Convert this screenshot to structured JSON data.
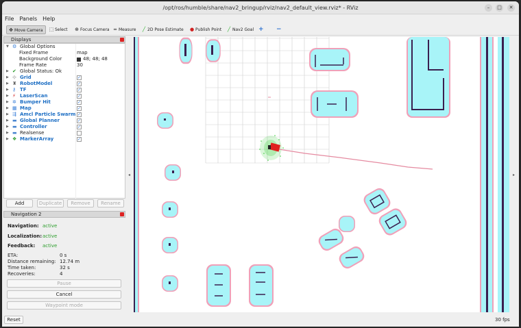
{
  "window": {
    "title": "/opt/ros/humble/share/nav2_bringup/rviz/nav2_default_view.rviz* - RViz",
    "minimize": "–",
    "maximize": "□",
    "close": "✕"
  },
  "menu": {
    "file": "File",
    "panels": "Panels",
    "help": "Help"
  },
  "toolbar": {
    "move_camera": "Move Camera",
    "select": "Select",
    "focus_camera": "Focus Camera",
    "measure": "Measure",
    "pose_estimate": "2D Pose Estimate",
    "publish_point": "Publish Point",
    "nav2_goal": "Nav2 Goal",
    "add_tool": "+",
    "remove_tool": "−"
  },
  "displays": {
    "title": "Displays",
    "items": [
      {
        "label": "Global Options",
        "icon": "gear-icon",
        "expanded": true
      },
      {
        "label": "Fixed Frame",
        "value": "map"
      },
      {
        "label": "Background Color",
        "value": "48; 48; 48"
      },
      {
        "label": "Frame Rate",
        "value": "30"
      },
      {
        "label": "Global Status: Ok",
        "icon": "check-icon"
      },
      {
        "label": "Grid",
        "icon": "grid-icon",
        "checked": true
      },
      {
        "label": "RobotModel",
        "icon": "robot-icon",
        "checked": true
      },
      {
        "label": "TF",
        "icon": "tf-icon",
        "checked": true
      },
      {
        "label": "LaserScan",
        "icon": "laser-icon",
        "checked": true
      },
      {
        "label": "Bumper Hit",
        "icon": "bumper-icon",
        "checked": true
      },
      {
        "label": "Map",
        "icon": "map-icon",
        "checked": true
      },
      {
        "label": "Amcl Particle Swarm",
        "icon": "particle-icon",
        "checked": true
      },
      {
        "label": "Global Planner",
        "icon": "folder-icon",
        "checked": true
      },
      {
        "label": "Controller",
        "icon": "folder-icon",
        "checked": true
      },
      {
        "label": "Realsense",
        "icon": "folder-icon",
        "checked": false
      },
      {
        "label": "MarkerArray",
        "icon": "marker-icon",
        "checked": true
      }
    ],
    "buttons": {
      "add": "Add",
      "duplicate": "Duplicate",
      "remove": "Remove",
      "rename": "Rename"
    }
  },
  "navigation": {
    "title": "Navigation 2",
    "navigation_label": "Navigation:",
    "navigation_value": "active",
    "localization_label": "Localization:",
    "localization_value": "active",
    "feedback_label": "Feedback:",
    "feedback_value": "active",
    "eta_label": "ETA:",
    "eta_value": "0 s",
    "distance_label": "Distance remaining:",
    "distance_value": "12.74 m",
    "time_label": "Time taken:",
    "time_value": "32 s",
    "recoveries_label": "Recoveries:",
    "recoveries_value": "4",
    "pause": "Pause",
    "cancel": "Cancel",
    "waypoint": "Waypoint mode"
  },
  "status": {
    "reset": "Reset",
    "fps": "30 fps"
  },
  "colors": {
    "inflation": "#a8f4f8",
    "inflation_edge": "#f0a0b8",
    "obstacle": "#3a1f4f",
    "path": "#e58aa0",
    "particles": "#33cc33",
    "robot": "#e02020"
  }
}
